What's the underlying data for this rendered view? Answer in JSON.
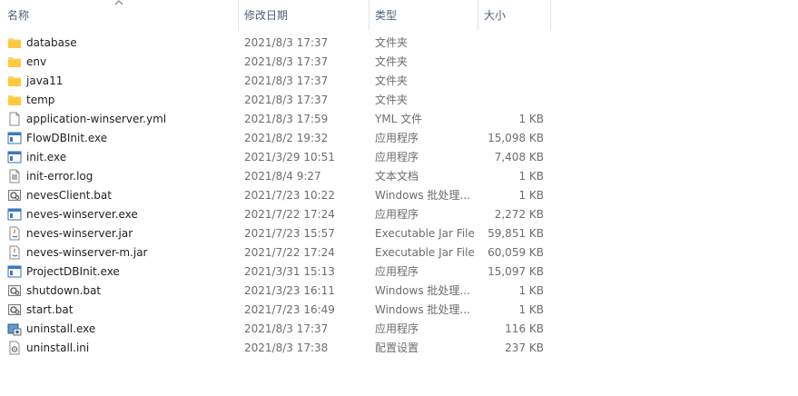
{
  "columns": {
    "name": "名称",
    "date": "修改日期",
    "type": "类型",
    "size": "大小"
  },
  "sort": {
    "column": "name",
    "direction": "ascending",
    "icon": "chevron-up-icon"
  },
  "files": [
    {
      "name": "database",
      "date": "2021/8/3 17:37",
      "type": "文件夹",
      "size": "",
      "icon": "folder-icon"
    },
    {
      "name": "env",
      "date": "2021/8/3 17:37",
      "type": "文件夹",
      "size": "",
      "icon": "folder-icon"
    },
    {
      "name": "java11",
      "date": "2021/8/3 17:37",
      "type": "文件夹",
      "size": "",
      "icon": "folder-icon"
    },
    {
      "name": "temp",
      "date": "2021/8/3 17:37",
      "type": "文件夹",
      "size": "",
      "icon": "folder-icon"
    },
    {
      "name": "application-winserver.yml",
      "date": "2021/8/3 17:59",
      "type": "YML 文件",
      "size": "1 KB",
      "icon": "document-icon"
    },
    {
      "name": "FlowDBInit.exe",
      "date": "2021/8/2 19:32",
      "type": "应用程序",
      "size": "15,098 KB",
      "icon": "application-icon"
    },
    {
      "name": "init.exe",
      "date": "2021/3/29 10:51",
      "type": "应用程序",
      "size": "7,408 KB",
      "icon": "application-icon"
    },
    {
      "name": "init-error.log",
      "date": "2021/8/4 9:27",
      "type": "文本文档",
      "size": "1 KB",
      "icon": "text-file-icon"
    },
    {
      "name": "nevesClient.bat",
      "date": "2021/7/23 10:22",
      "type": "Windows 批处理...",
      "size": "1 KB",
      "icon": "batch-file-icon"
    },
    {
      "name": "neves-winserver.exe",
      "date": "2021/7/22 17:24",
      "type": "应用程序",
      "size": "2,272 KB",
      "icon": "application-icon"
    },
    {
      "name": "neves-winserver.jar",
      "date": "2021/7/23 15:57",
      "type": "Executable Jar File",
      "size": "59,851 KB",
      "icon": "jar-file-icon"
    },
    {
      "name": "neves-winserver-m.jar",
      "date": "2021/7/22 17:24",
      "type": "Executable Jar File",
      "size": "60,059 KB",
      "icon": "jar-file-icon"
    },
    {
      "name": "ProjectDBInit.exe",
      "date": "2021/3/31 15:13",
      "type": "应用程序",
      "size": "15,097 KB",
      "icon": "application-icon"
    },
    {
      "name": "shutdown.bat",
      "date": "2021/3/23 16:11",
      "type": "Windows 批处理...",
      "size": "1 KB",
      "icon": "batch-file-icon"
    },
    {
      "name": "start.bat",
      "date": "2021/7/23 16:49",
      "type": "Windows 批处理...",
      "size": "1 KB",
      "icon": "batch-file-icon"
    },
    {
      "name": "uninstall.exe",
      "date": "2021/8/3 17:37",
      "type": "应用程序",
      "size": "116 KB",
      "icon": "installer-icon"
    },
    {
      "name": "uninstall.ini",
      "date": "2021/8/3 17:38",
      "type": "配置设置",
      "size": "237 KB",
      "icon": "config-file-icon"
    }
  ]
}
